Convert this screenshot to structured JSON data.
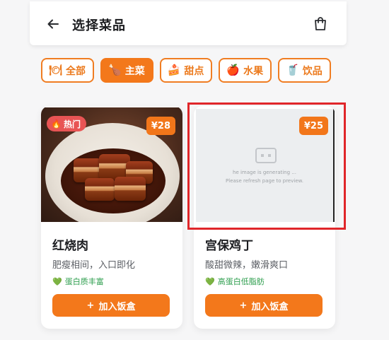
{
  "header": {
    "title": "选择菜品",
    "back_icon": "arrow-left-icon",
    "cart_icon": "shopping-bag-icon"
  },
  "tabs": [
    {
      "label": "全部",
      "icon": "🍽",
      "active": false
    },
    {
      "label": "主菜",
      "icon": "🍗",
      "active": true
    },
    {
      "label": "甜点",
      "icon": "🍰",
      "active": false
    },
    {
      "label": "水果",
      "icon": "🍎",
      "active": false
    },
    {
      "label": "饮品",
      "icon": "🥤",
      "active": false
    }
  ],
  "dishes": [
    {
      "name": "红烧肉",
      "description": "肥瘦相间，入口即化",
      "price": "¥28",
      "badge": "热门",
      "badge_icon": "🔥",
      "tag": "蛋白质丰富",
      "tag_icon": "💚",
      "button_label": "加入饭盒",
      "button_icon": "+"
    },
    {
      "name": "宫保鸡丁",
      "description": "酸甜微辣，嫩滑爽口",
      "price": "¥25",
      "placeholder_line1": "he image is generating ...",
      "placeholder_line2": "Please refresh page to preview.",
      "tag": "高蛋白低脂肪",
      "tag_icon": "💚",
      "button_label": "加入饭盒",
      "button_icon": "+"
    }
  ],
  "colors": {
    "accent": "#f3781b",
    "badge_red": "#e85454",
    "tag_green": "#2e9e4e",
    "highlight_border": "#e0262a"
  }
}
